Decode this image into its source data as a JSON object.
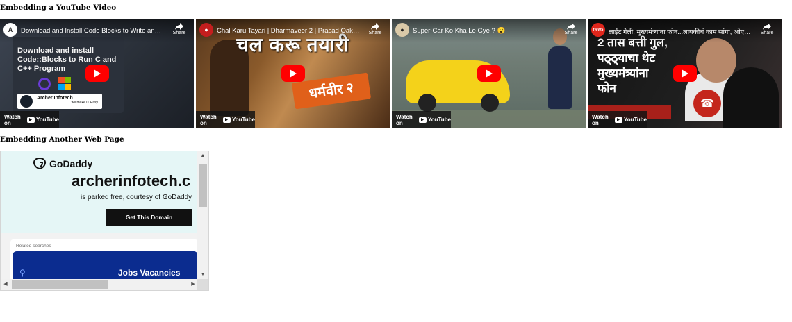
{
  "headings": {
    "youtube": "Embedding a YouTube Video",
    "webpage": "Embedding Another Web Page"
  },
  "videos": [
    {
      "title": "Download and Install Code Blocks to Write and Ru...",
      "channel_initial": "A",
      "share_label": "Share",
      "watch_on": "Watch on",
      "youtube": "YouTube",
      "thumb_text": "Download and install Code::Blocks to Run C and C++ Program",
      "badge_name": "Archer Infotech",
      "badge_tagline": "we make IT Easy"
    },
    {
      "title": "Chal Karu Tayari | Dharmaveer 2 | Prasad Oak | Vis...",
      "channel_initial": "●",
      "share_label": "Share",
      "watch_on": "Watch on",
      "youtube": "YouTube",
      "thumb_text": "चल करू तयारी",
      "logo_text": "धर्मवीर २"
    },
    {
      "title": "Super-Car Ko Kha Le Gye ? 😮",
      "channel_initial": "●",
      "share_label": "Share",
      "watch_on": "Watch on",
      "youtube": "YouTube"
    },
    {
      "title": "लाईट गेली, मुख्यमंत्र्यांना फोन...लायकीचं काम सांगा, ओएस...",
      "channel_initial": "news",
      "share_label": "Share",
      "watch_on": "Watch on",
      "youtube": "YouTube",
      "thumb_text_lines": [
        "2 तास बत्ती गुल,",
        "पठ्ठ्याचा थेट",
        "मुख्यमंत्र्यांना",
        "फोन"
      ]
    }
  ],
  "embedded_page": {
    "logo": "GoDaddy",
    "domain": "archerinfotech.c",
    "parked_text": "is parked free, courtesy of GoDaddy",
    "cta": "Get This Domain",
    "related_label": "Related searches",
    "search_result": "Jobs Vacancies"
  },
  "colors": {
    "youtube_red": "#ff0000",
    "godaddy_bg": "#e5f6f6",
    "jobs_bg": "#0b2c8f"
  }
}
